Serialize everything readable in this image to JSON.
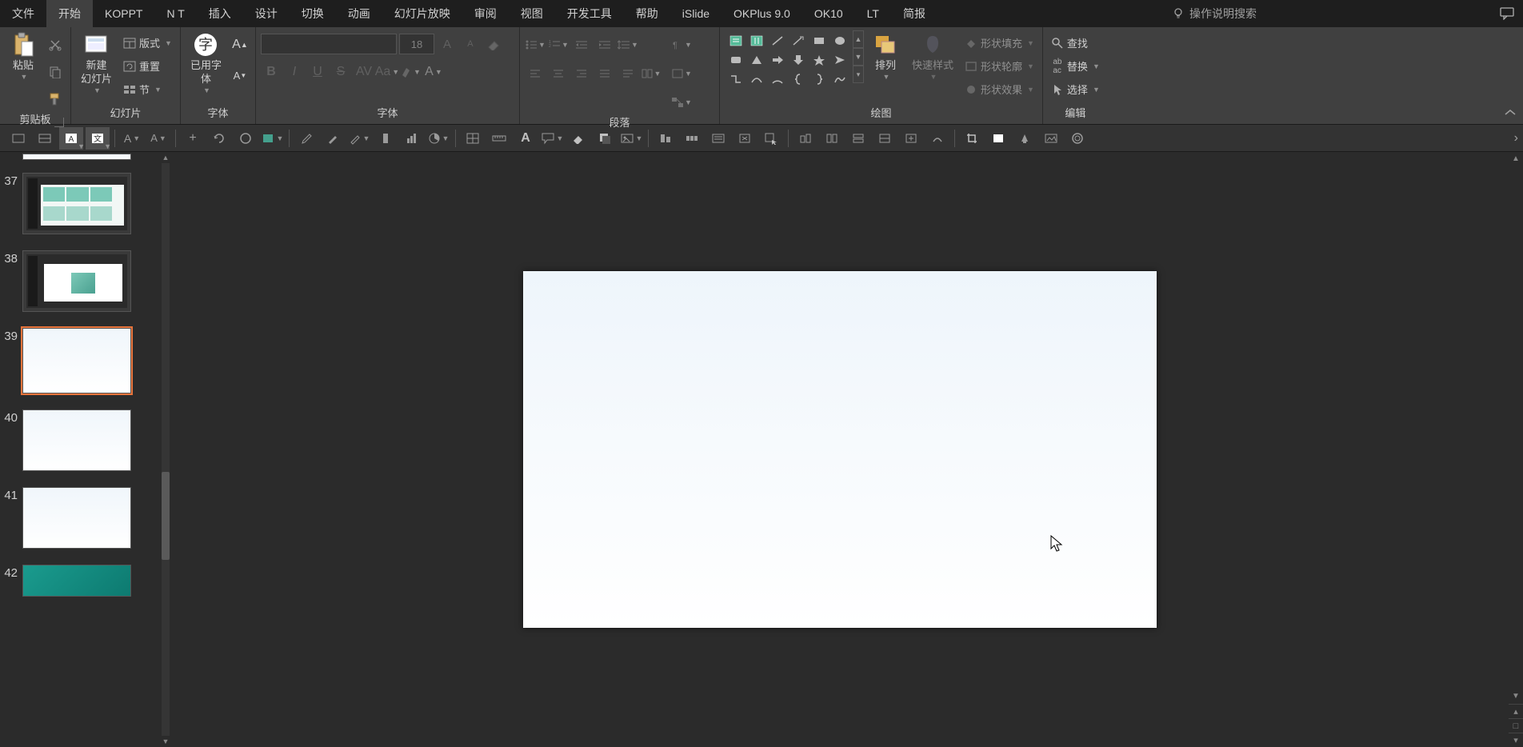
{
  "menu": {
    "tabs": [
      "文件",
      "开始",
      "KOPPT",
      "N T",
      "插入",
      "设计",
      "切换",
      "动画",
      "幻灯片放映",
      "审阅",
      "视图",
      "开发工具",
      "帮助",
      "iSlide",
      "OKPlus 9.0",
      "OK10",
      "LT",
      "简报"
    ],
    "active_index": 1,
    "tell_me": "操作说明搜索"
  },
  "ribbon": {
    "clipboard": {
      "label": "剪贴板",
      "paste": "粘贴"
    },
    "slides": {
      "label": "幻灯片",
      "new_slide": "新建\n幻灯片",
      "layout": "版式",
      "reset": "重置",
      "section": "节"
    },
    "font_group": {
      "label": "字体",
      "used_font": "已用字\n体",
      "size": "18"
    },
    "paragraph": {
      "label": "段落"
    },
    "drawing": {
      "label": "绘图",
      "arrange": "排列",
      "quick_styles": "快速样式",
      "shape_fill": "形状填充",
      "shape_outline": "形状轮廓",
      "shape_effects": "形状效果"
    },
    "editing": {
      "label": "编辑",
      "find": "查找",
      "replace": "替换",
      "select": "选择"
    }
  },
  "thumbs": {
    "items": [
      {
        "num": "37",
        "kind": "dark-content"
      },
      {
        "num": "38",
        "kind": "dark-content"
      },
      {
        "num": "39",
        "kind": "gradient",
        "selected": true
      },
      {
        "num": "40",
        "kind": "gradient"
      },
      {
        "num": "41",
        "kind": "gradient"
      },
      {
        "num": "42",
        "kind": "teal"
      }
    ]
  }
}
